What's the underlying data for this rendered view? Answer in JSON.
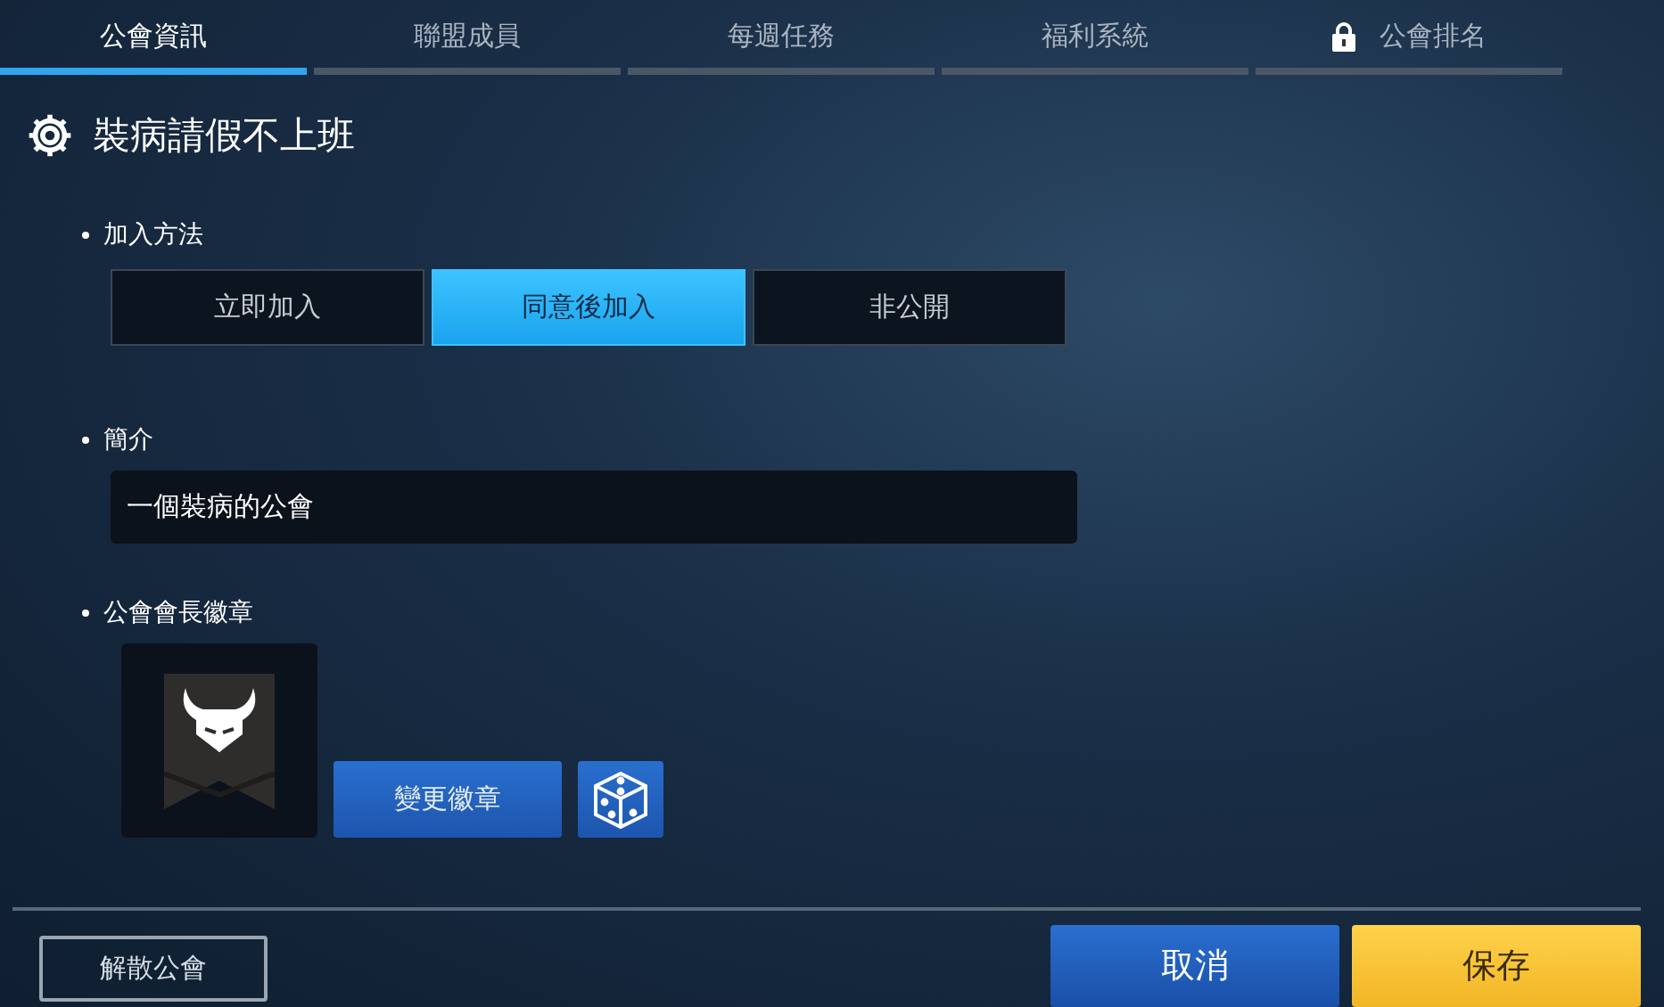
{
  "tabs": [
    {
      "label": "公會資訊",
      "selected": true,
      "locked": false
    },
    {
      "label": "聯盟成員",
      "selected": false,
      "locked": false
    },
    {
      "label": "每週任務",
      "selected": false,
      "locked": false
    },
    {
      "label": "福利系統",
      "selected": false,
      "locked": false
    },
    {
      "label": "公會排名",
      "selected": false,
      "locked": true
    }
  ],
  "guild_name": "裝病請假不上班",
  "join_method": {
    "label": "加入方法",
    "options": [
      {
        "label": "立即加入",
        "selected": false
      },
      {
        "label": "同意後加入",
        "selected": true
      },
      {
        "label": "非公開",
        "selected": false
      }
    ]
  },
  "intro": {
    "label": "簡介",
    "value": "一個裝病的公會"
  },
  "badge": {
    "label": "公會會長徽章",
    "change_button": "變更徽章"
  },
  "footer": {
    "disband": "解散公會",
    "cancel": "取消",
    "save": "保存"
  }
}
